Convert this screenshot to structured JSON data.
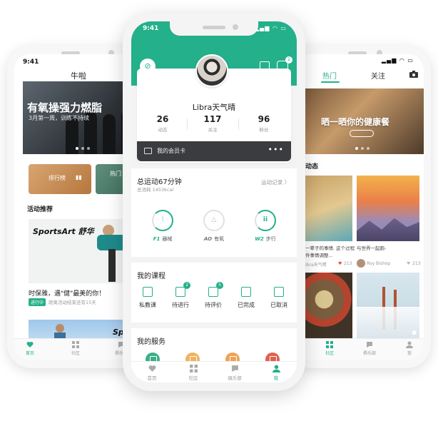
{
  "left_phone": {
    "status_time": "9:41",
    "title": "牛啦",
    "hero": {
      "title": "有氧操强力燃脂",
      "subtitle": "3月第一周，训练不持续"
    },
    "cards": [
      {
        "label": "排行榜"
      },
      {
        "label": "热门"
      }
    ],
    "section_title": "活动推荐",
    "brand_text": "SportsArt 舒华",
    "promo": {
      "title": "时保雅，遇\"健\"最美的你！",
      "badge": "进行中",
      "sub": "距离活动结束还有15天"
    },
    "brand_text_2": "Spor",
    "tabbar": [
      "首页",
      "社区",
      "俱乐部"
    ]
  },
  "center_phone": {
    "status_time": "9:41",
    "status_icons": "▂▄▆ ◠ ▭",
    "link_icon": "⊘",
    "message_badge": "2",
    "user_name": "Libra天气晴",
    "stats": [
      {
        "value": "26",
        "label": "动态"
      },
      {
        "value": "117",
        "label": "关注"
      },
      {
        "value": "96",
        "label": "粉丝"
      }
    ],
    "vip_label": "我的会员卡",
    "vip_more": "•••",
    "sport": {
      "title": "总运动67分钟",
      "sub": "总消耗 1453kcal",
      "link": "运动记录 〉",
      "devices": [
        {
          "code": "F1",
          "label": "器械",
          "ring_text": "⫶"
        },
        {
          "code": "AO",
          "label": "有氧",
          "ring_text": "△"
        },
        {
          "code": "W2",
          "label": "步行",
          "ring_text": "ⅰⅰ"
        }
      ]
    },
    "courses": {
      "title": "我的课程",
      "items": [
        {
          "label": "私教课",
          "count": ""
        },
        {
          "label": "待进行",
          "count": "2"
        },
        {
          "label": "待评价",
          "count": "5"
        },
        {
          "label": "已完成",
          "count": ""
        },
        {
          "label": "已取消",
          "count": ""
        }
      ]
    },
    "services": {
      "title": "我的服务",
      "colors": [
        "#3aaf8a",
        "#f0b35d",
        "#f0a255",
        "#e0604e"
      ]
    },
    "tabbar": [
      "首页",
      "社区",
      "俱乐部",
      "我"
    ]
  },
  "right_phone": {
    "status_icons": "▂▄▆ ◠ ▭",
    "tabs": [
      "热门",
      "关注"
    ],
    "hero_title": "晒一晒你的健康餐",
    "section_label": "动态",
    "post1": {
      "caption": "一辈子的事情. 这个过程",
      "sub": "件事情调整...",
      "user": "ibra天气晴",
      "likes": "213"
    },
    "post2": {
      "caption": "与世界一起跑-",
      "user": "Roy Bishop",
      "likes": "213"
    },
    "tabbar": [
      "社区",
      "俱乐部",
      "我"
    ]
  },
  "colors": {
    "accent": "#23b08a"
  }
}
